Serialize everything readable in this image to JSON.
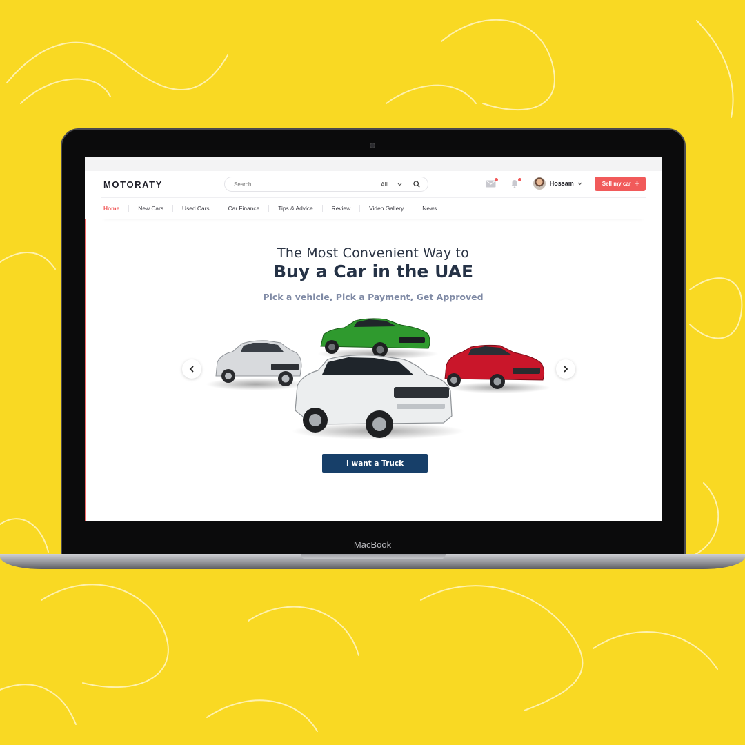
{
  "device": {
    "brand_label": "MacBook"
  },
  "header": {
    "logo": "MOTORATY",
    "search": {
      "placeholder": "Search...",
      "selected_category": "All"
    },
    "user_name": "Hossam",
    "sell_button": "Sell my car"
  },
  "nav": {
    "items": [
      {
        "label": "Home",
        "active": true
      },
      {
        "label": "New Cars",
        "active": false
      },
      {
        "label": "Used Cars",
        "active": false
      },
      {
        "label": "Car Finance",
        "active": false
      },
      {
        "label": "Tips & Advice",
        "active": false
      },
      {
        "label": "Review",
        "active": false
      },
      {
        "label": "Video Gallery",
        "active": false
      },
      {
        "label": "News",
        "active": false
      }
    ]
  },
  "hero": {
    "title_line1": "The Most Convenient Way to",
    "title_line2": "Buy a Car in the UAE",
    "subtitle": "Pick a vehicle, Pick a Payment, Get Approved",
    "cta": "I want a Truck",
    "cars": [
      {
        "name": "silver-sedan",
        "color": "#d7d9dc"
      },
      {
        "name": "green-sports-car",
        "color": "#2f9a2e"
      },
      {
        "name": "red-hatchback",
        "color": "#c9162a"
      },
      {
        "name": "white-suv",
        "color": "#eceeef"
      }
    ]
  },
  "icons": {
    "search": "search-icon",
    "mail": "mail-icon",
    "bell": "bell-icon",
    "chevron": "chevron-down-icon",
    "prev": "chevron-left-icon",
    "next": "chevron-right-icon",
    "plus": "plus-icon"
  },
  "colors": {
    "background": "#f9d923",
    "accent": "#f15a5a",
    "cta": "#173f69",
    "title": "#253246",
    "subtitle": "#7f8aa5"
  }
}
